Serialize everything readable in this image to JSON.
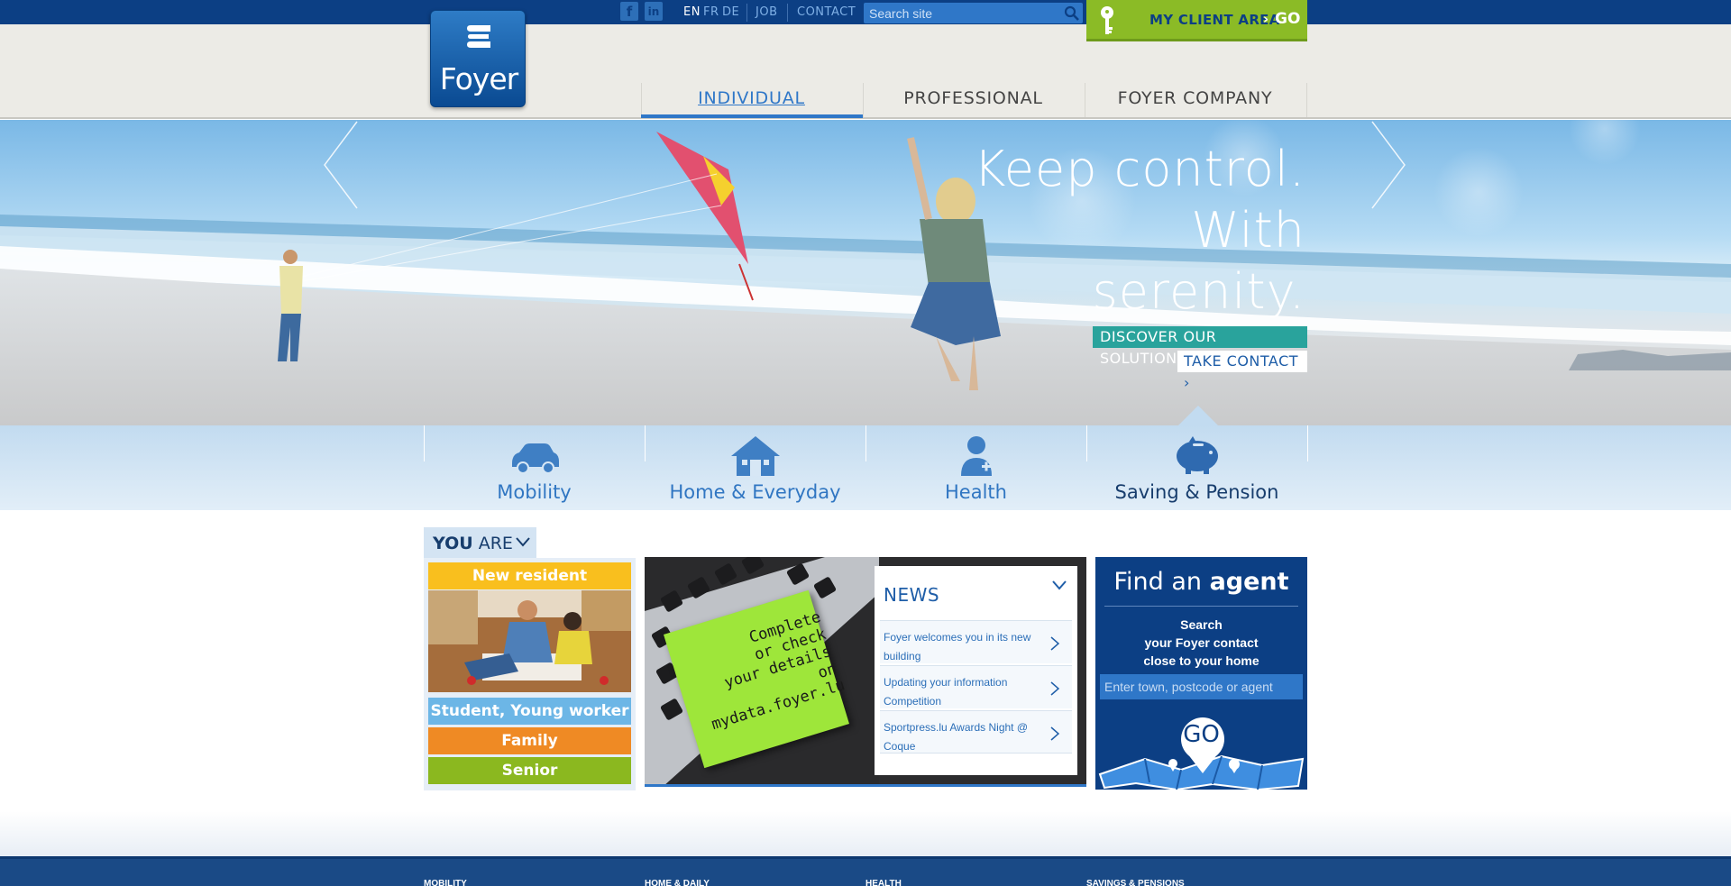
{
  "brand": {
    "name": "Foyer",
    "color_primary": "#0c3f84",
    "color_accent": "#2f77c8",
    "color_green": "#8bbb26"
  },
  "topbar": {
    "social": [
      {
        "icon": "facebook-icon",
        "glyph": "f"
      },
      {
        "icon": "linkedin-icon",
        "glyph": "in"
      }
    ],
    "languages": [
      {
        "code": "EN",
        "active": true
      },
      {
        "code": "FR",
        "active": false
      },
      {
        "code": "DE",
        "active": false
      }
    ],
    "links": {
      "job": "JOB",
      "contact": "CONTACT"
    },
    "search": {
      "placeholder": "Search site",
      "icon": "search-icon"
    },
    "client_area": {
      "label": "MY CLIENT AREA",
      "arrow": "›",
      "go": "GO",
      "icon": "key-icon"
    }
  },
  "nav": {
    "tabs": [
      {
        "label": "INDIVIDUAL",
        "active": true
      },
      {
        "label": "PROFESSIONAL",
        "active": false
      },
      {
        "label": "FOYER COMPANY",
        "active": false
      }
    ]
  },
  "hero": {
    "title_lines": [
      "Keep control.",
      "With",
      "serenity."
    ],
    "cta_primary": "DISCOVER OUR SOLUTIONS ›",
    "cta_secondary": "TAKE CONTACT ›",
    "prev_icon": "chevron-left-icon",
    "next_icon": "chevron-right-icon"
  },
  "categories": [
    {
      "label": "Mobility",
      "icon": "car-icon",
      "active": false
    },
    {
      "label": "Home & Everyday",
      "icon": "house-icon",
      "active": false
    },
    {
      "label": "Health",
      "icon": "person-plus-icon",
      "active": false
    },
    {
      "label": "Saving & Pension",
      "icon": "piggy-bank-icon",
      "active": true
    }
  ],
  "you_are": {
    "label_bold": "YOU",
    "label_rest": " ARE",
    "buttons": [
      {
        "label": "New resident",
        "color": "#f9bf1e"
      },
      {
        "label": "Student, Young worker",
        "color": "#6cb6e6"
      },
      {
        "label": "Family",
        "color": "#ef8a24"
      },
      {
        "label": "Senior",
        "color": "#8bb81f"
      }
    ]
  },
  "news": {
    "sticky_note": [
      "Complete",
      "or check",
      "your details",
      "on",
      "mydata.foyer.lu"
    ],
    "title": "NEWS",
    "items": [
      {
        "text": "Foyer welcomes you in its new building"
      },
      {
        "text": "Updating your information Competition"
      },
      {
        "text": "Sportpress.lu Awards Night @ Coque"
      }
    ]
  },
  "agent": {
    "title_plain": "Find an ",
    "title_bold": "agent",
    "sub_lines": [
      "Search",
      "your Foyer contact",
      "close to your home"
    ],
    "placeholder": "Enter town, postcode or agent",
    "go": "GO"
  },
  "footer": {
    "columns": [
      "MOBILITY",
      "HOME & DAILY",
      "HEALTH",
      "SAVINGS & PENSIONS"
    ]
  }
}
